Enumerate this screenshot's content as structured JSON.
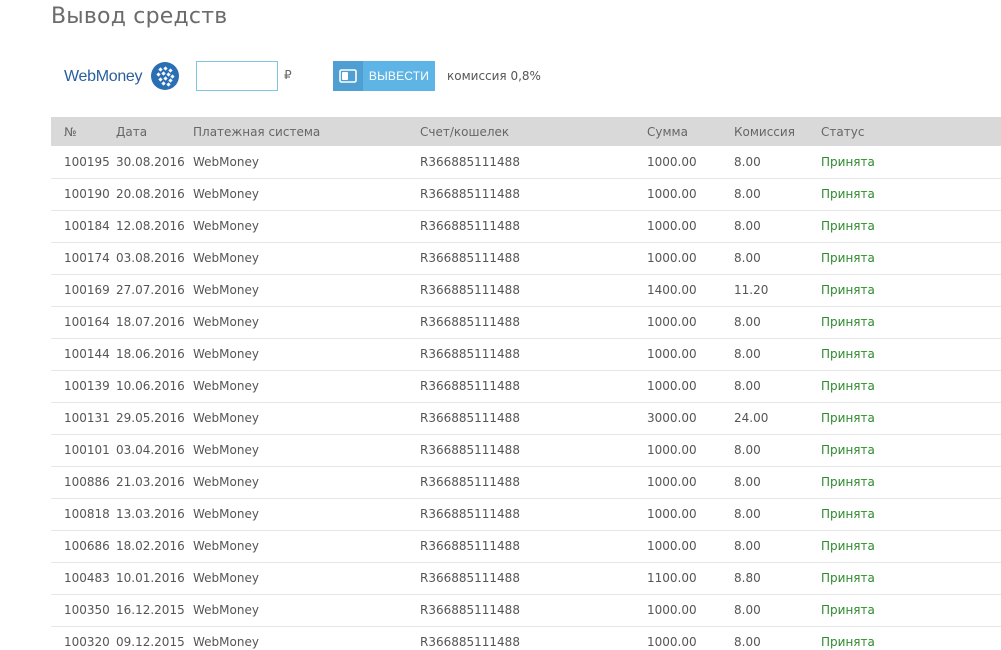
{
  "page": {
    "title": "Вывод средств"
  },
  "withdraw": {
    "provider_name": "WebMoney",
    "amount_value": "",
    "currency_sign": "₽",
    "button_label": "ВЫВЕСТИ",
    "commission_note": "комиссия 0,8%"
  },
  "table": {
    "headers": {
      "num": "№",
      "date": "Дата",
      "system": "Платежная система",
      "account": "Счет/кошелек",
      "sum": "Сумма",
      "fee": "Комиссия",
      "status": "Статус"
    },
    "rows": [
      {
        "num": "100195",
        "date": "30.08.2016",
        "system": "WebMoney",
        "account": "R366885111488",
        "sum": "1000.00",
        "fee": "8.00",
        "status": "Принята"
      },
      {
        "num": "100190",
        "date": "20.08.2016",
        "system": "WebMoney",
        "account": "R366885111488",
        "sum": "1000.00",
        "fee": "8.00",
        "status": "Принята"
      },
      {
        "num": "100184",
        "date": "12.08.2016",
        "system": "WebMoney",
        "account": "R366885111488",
        "sum": "1000.00",
        "fee": "8.00",
        "status": "Принята"
      },
      {
        "num": "100174",
        "date": "03.08.2016",
        "system": "WebMoney",
        "account": "R366885111488",
        "sum": "1000.00",
        "fee": "8.00",
        "status": "Принята"
      },
      {
        "num": "100169",
        "date": "27.07.2016",
        "system": "WebMoney",
        "account": "R366885111488",
        "sum": "1400.00",
        "fee": "11.20",
        "status": "Принята"
      },
      {
        "num": "100164",
        "date": "18.07.2016",
        "system": "WebMoney",
        "account": "R366885111488",
        "sum": "1000.00",
        "fee": "8.00",
        "status": "Принята"
      },
      {
        "num": "100144",
        "date": "18.06.2016",
        "system": "WebMoney",
        "account": "R366885111488",
        "sum": "1000.00",
        "fee": "8.00",
        "status": "Принята"
      },
      {
        "num": "100139",
        "date": "10.06.2016",
        "system": "WebMoney",
        "account": "R366885111488",
        "sum": "1000.00",
        "fee": "8.00",
        "status": "Принята"
      },
      {
        "num": "100131",
        "date": "29.05.2016",
        "system": "WebMoney",
        "account": "R366885111488",
        "sum": "3000.00",
        "fee": "24.00",
        "status": "Принята"
      },
      {
        "num": "100101",
        "date": "03.04.2016",
        "system": "WebMoney",
        "account": "R366885111488",
        "sum": "1000.00",
        "fee": "8.00",
        "status": "Принята"
      },
      {
        "num": "100886",
        "date": "21.03.2016",
        "system": "WebMoney",
        "account": "R366885111488",
        "sum": "1000.00",
        "fee": "8.00",
        "status": "Принята"
      },
      {
        "num": "100818",
        "date": "13.03.2016",
        "system": "WebMoney",
        "account": "R366885111488",
        "sum": "1000.00",
        "fee": "8.00",
        "status": "Принята"
      },
      {
        "num": "100686",
        "date": "18.02.2016",
        "system": "WebMoney",
        "account": "R366885111488",
        "sum": "1000.00",
        "fee": "8.00",
        "status": "Принята"
      },
      {
        "num": "100483",
        "date": "10.01.2016",
        "system": "WebMoney",
        "account": "R366885111488",
        "sum": "1100.00",
        "fee": "8.80",
        "status": "Принята"
      },
      {
        "num": "100350",
        "date": "16.12.2015",
        "system": "WebMoney",
        "account": "R366885111488",
        "sum": "1000.00",
        "fee": "8.00",
        "status": "Принята"
      },
      {
        "num": "100320",
        "date": "09.12.2015",
        "system": "WebMoney",
        "account": "R366885111488",
        "sum": "1000.00",
        "fee": "8.00",
        "status": "Принята"
      }
    ]
  },
  "icons": {
    "provider_logo": "webmoney-globe-icon",
    "button_icon": "wallet-icon"
  },
  "colors": {
    "accent": "#5fb4e6",
    "status_ok": "#2e8b2e",
    "header_bg": "#d9d9d9",
    "brand": "#2a5f9e"
  }
}
